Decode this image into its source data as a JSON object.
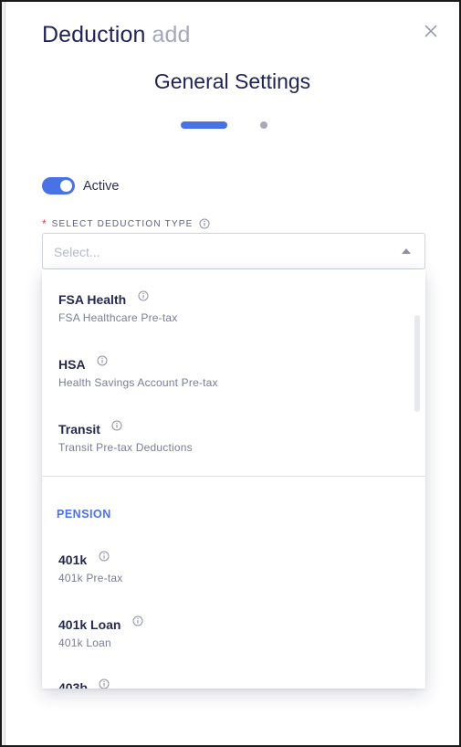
{
  "header": {
    "title": "Deduction",
    "subtitle": "add",
    "close_icon": "close-icon"
  },
  "wizard": {
    "step_title": "General Settings",
    "steps_total": 2,
    "current_step": 1
  },
  "active_toggle": {
    "label": "Active",
    "on": true
  },
  "deduction_type": {
    "required_mark": "*",
    "label": "SELECT DEDUCTION TYPE",
    "placeholder": "Select..."
  },
  "dropdown": {
    "health_options": [
      {
        "name": "FSA Health",
        "desc": "FSA Healthcare Pre-tax"
      },
      {
        "name": "HSA",
        "desc": "Health Savings Account Pre-tax"
      },
      {
        "name": "Transit",
        "desc": "Transit Pre-tax Deductions"
      }
    ],
    "pension_group": "PENSION",
    "pension_options": [
      {
        "name": "401k",
        "desc": "401k Pre-tax"
      },
      {
        "name": "401k Loan",
        "desc": "401k Loan"
      },
      {
        "name": "403b",
        "desc": ""
      }
    ]
  },
  "colors": {
    "accent": "#4a72e8",
    "title": "#1f2356",
    "subtitle": "#a4a7bd",
    "required": "#e2354a"
  }
}
